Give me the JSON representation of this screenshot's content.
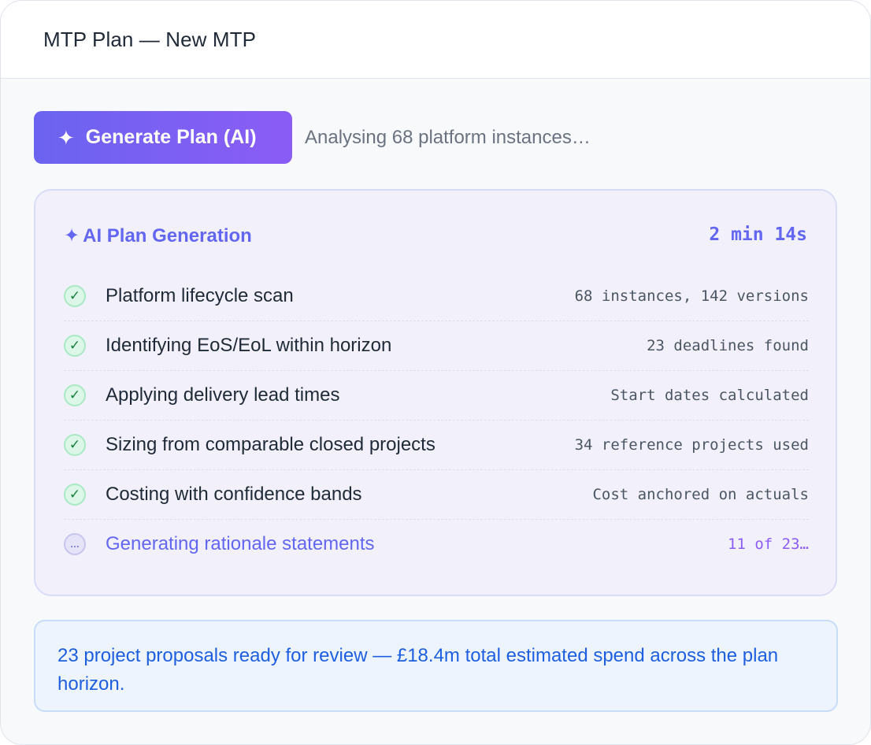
{
  "header": {
    "title": "MTP Plan — New MTP"
  },
  "generate_button": {
    "icon": "sparkle-icon",
    "label": "Generate Plan (AI)",
    "color_start": "#6b63f0",
    "color_end": "#8b5cf6"
  },
  "status_text": "Analysing 68 platform instances…",
  "generation_panel": {
    "title": "AI Plan Generation",
    "title_icon": "sparkle-icon",
    "elapsed": "2 min 14s",
    "accent_color": "#6366f1",
    "steps": [
      {
        "label": "Platform lifecycle scan",
        "detail": "68 instances, 142 versions",
        "state": "done",
        "icon": "check-icon"
      },
      {
        "label": "Identifying EoS/EoL within horizon",
        "detail": "23 deadlines found",
        "state": "done",
        "icon": "check-icon"
      },
      {
        "label": "Applying delivery lead times",
        "detail": "Start dates calculated",
        "state": "done",
        "icon": "check-icon"
      },
      {
        "label": "Sizing from comparable closed projects",
        "detail": "34 reference projects used",
        "state": "done",
        "icon": "check-icon"
      },
      {
        "label": "Costing with confidence bands",
        "detail": "Cost anchored on actuals",
        "state": "done",
        "icon": "check-icon"
      },
      {
        "label": "Generating rationale statements",
        "detail": "11 of 23…",
        "state": "in-progress",
        "icon": "ellipsis-icon"
      }
    ]
  },
  "result": {
    "text": "23 project proposals ready for review — £18.4m total estimated spend across the plan horizon.",
    "color": "#1d5fe0"
  }
}
